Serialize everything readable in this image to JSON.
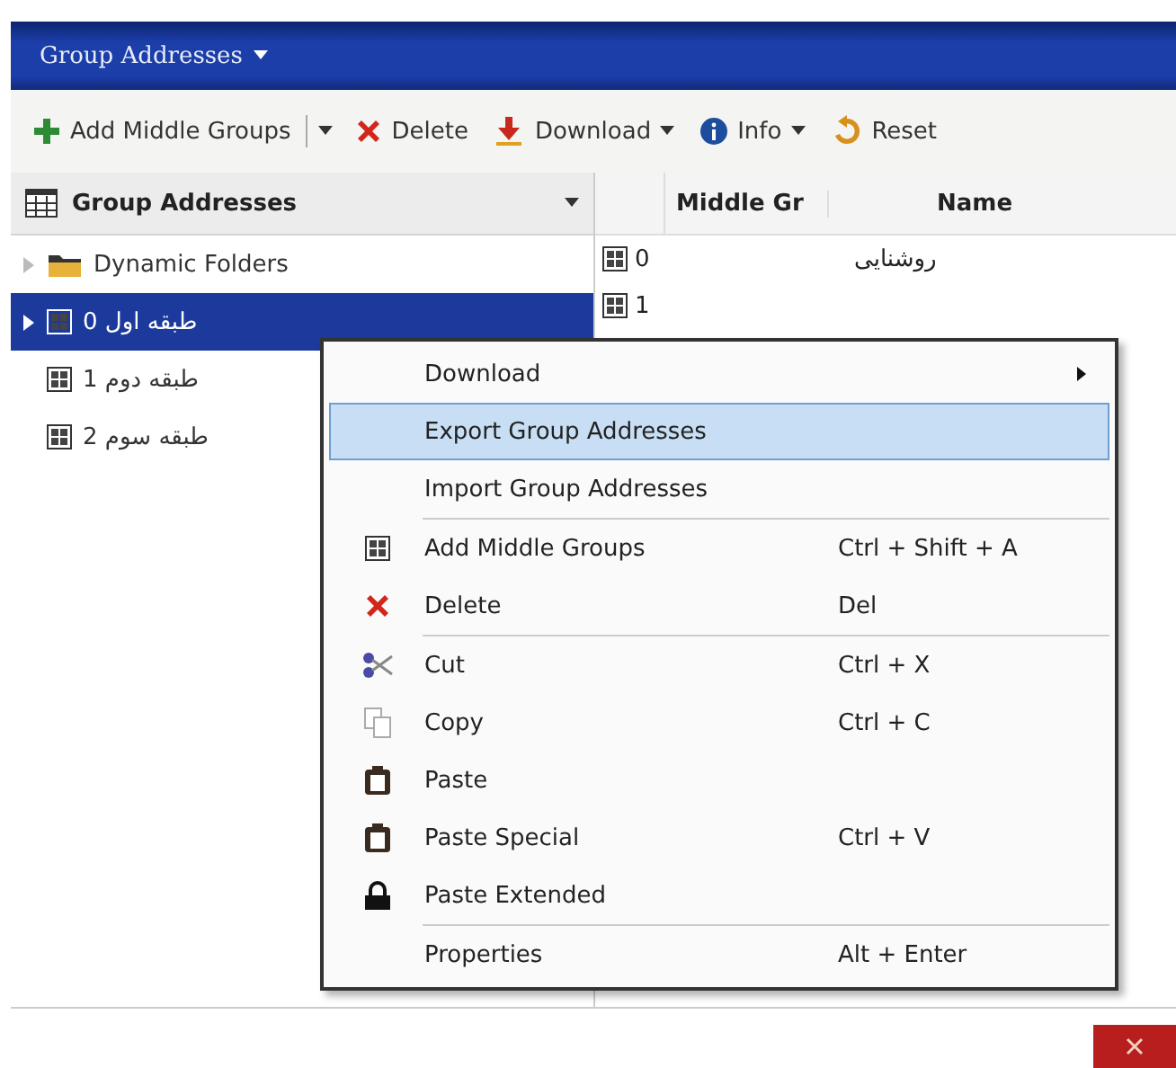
{
  "window": {
    "title": "Group Addresses"
  },
  "toolbar": [
    {
      "label": "Add Middle Groups",
      "kind": "split"
    },
    {
      "label": "Delete",
      "kind": "button"
    },
    {
      "label": "Download",
      "kind": "dropdown"
    },
    {
      "label": "Info",
      "kind": "dropdown"
    },
    {
      "label": "Reset",
      "kind": "button"
    }
  ],
  "tree": {
    "header": "Group Addresses",
    "items": [
      {
        "label": "Dynamic Folders",
        "kind": "folder",
        "selected": false,
        "expander": true
      },
      {
        "label": "0 طبقه اول",
        "kind": "group",
        "selected": true,
        "expander": true
      },
      {
        "label": "1 طبقه دوم",
        "kind": "group",
        "selected": false,
        "expander": false
      },
      {
        "label": "2 طبقه سوم",
        "kind": "group",
        "selected": false,
        "expander": false
      }
    ]
  },
  "table": {
    "columns": [
      "Middle Gr",
      "Name"
    ],
    "rows": [
      {
        "middle": "0",
        "name": "روشنایی"
      },
      {
        "middle": "1"
      }
    ]
  },
  "context_menu": [
    {
      "kind": "item",
      "label": "Download",
      "submenu": true,
      "selected": false
    },
    {
      "kind": "item",
      "label": "Export Group Addresses",
      "selected": true
    },
    {
      "kind": "item",
      "label": "Import Group Addresses",
      "selected": false
    },
    {
      "kind": "separator"
    },
    {
      "kind": "group",
      "label": "Add Middle Groups",
      "shortcut": "Ctrl + Shift + A",
      "selected": false
    },
    {
      "kind": "delete",
      "label": "Delete",
      "shortcut": "Del",
      "selected": false
    },
    {
      "kind": "separator"
    },
    {
      "kind": "cut",
      "label": "Cut",
      "shortcut": "Ctrl + X",
      "selected": false
    },
    {
      "kind": "copy",
      "label": "Copy",
      "shortcut": "Ctrl + C",
      "selected": false
    },
    {
      "kind": "paste",
      "label": "Paste",
      "selected": false
    },
    {
      "kind": "paste",
      "label": "Paste Special",
      "shortcut": "Ctrl + V",
      "selected": false
    },
    {
      "kind": "lock",
      "label": "Paste Extended",
      "selected": false
    },
    {
      "kind": "separator"
    },
    {
      "kind": "item",
      "label": "Properties",
      "shortcut": "Alt + Enter",
      "selected": false
    }
  ]
}
